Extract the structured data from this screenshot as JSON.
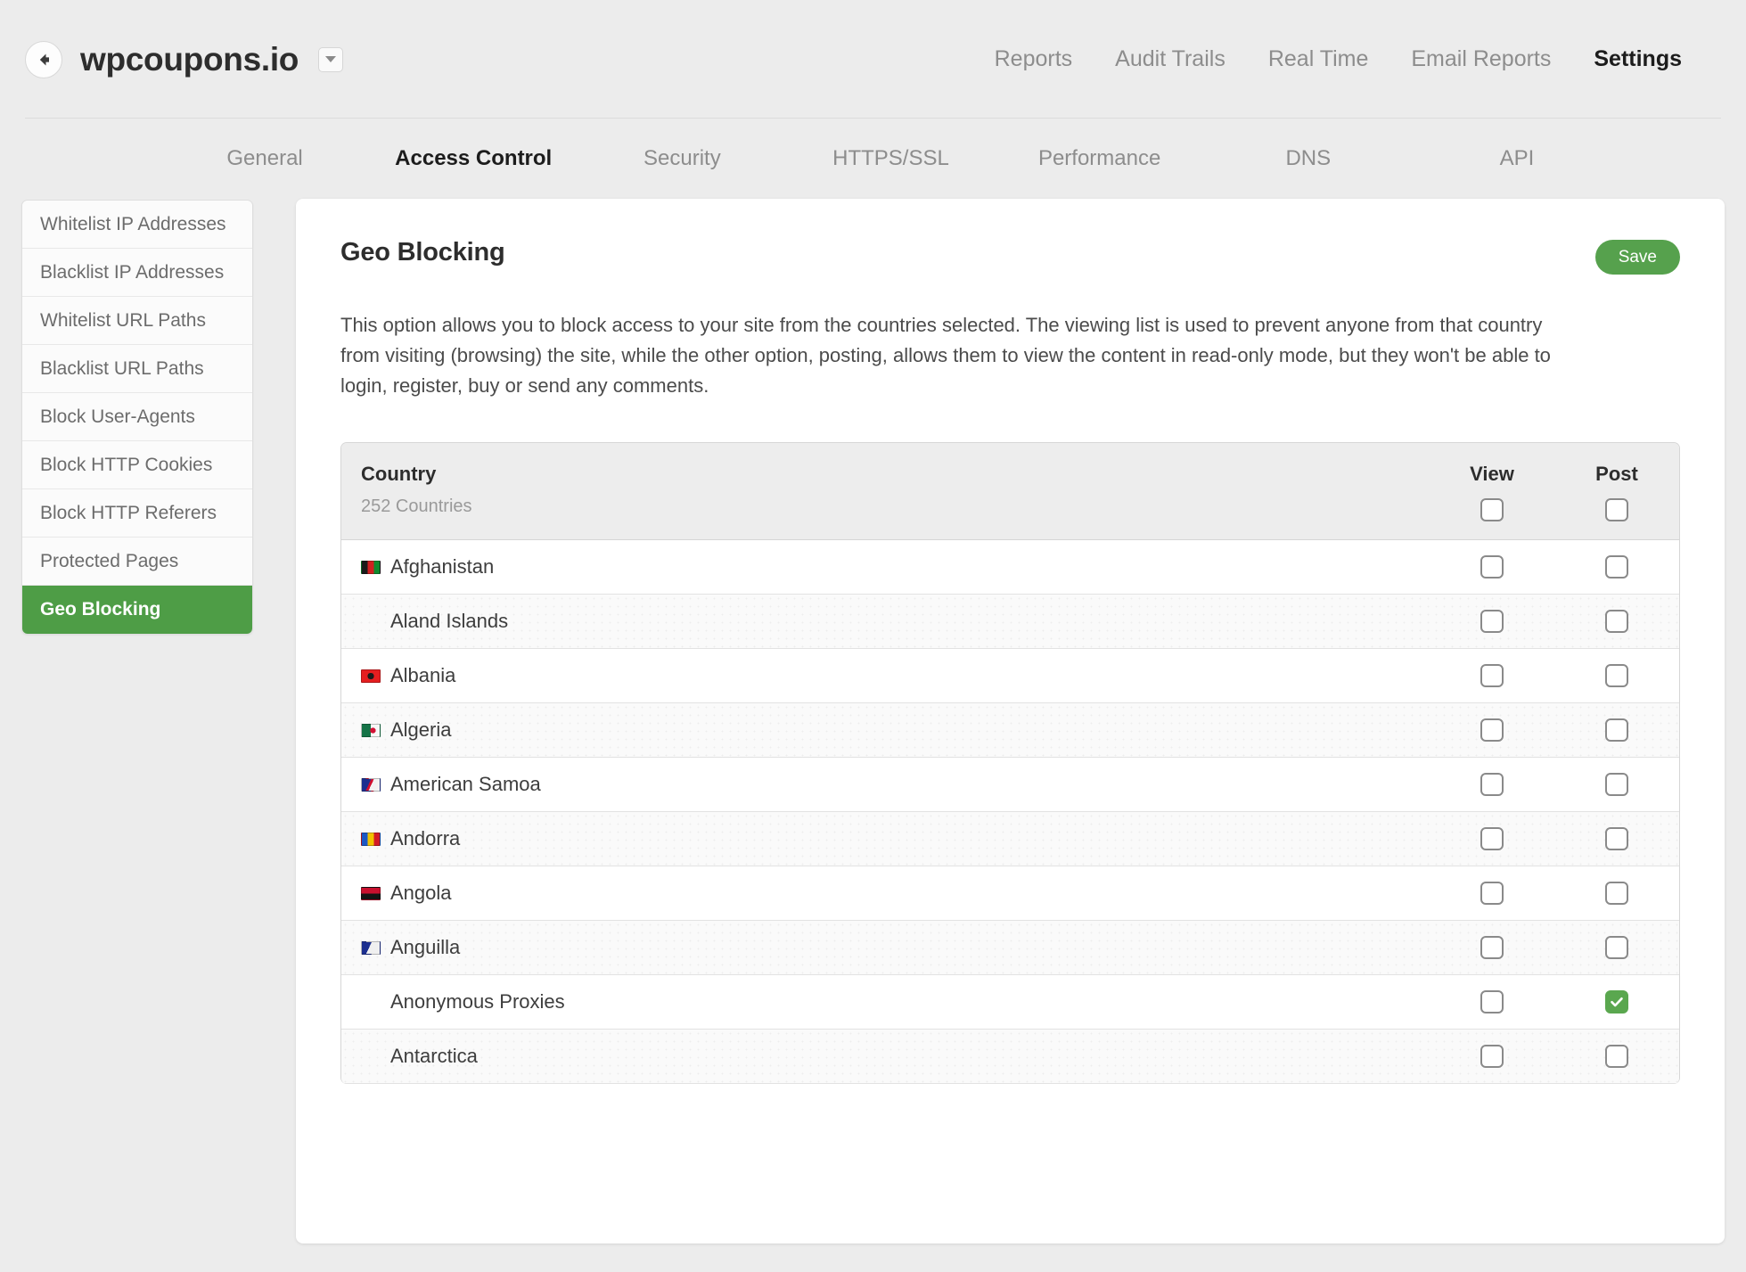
{
  "header": {
    "back_icon": "arrow-left-circle-icon",
    "site_title": "wpcoupons.io",
    "site_dropdown_icon": "chevron-down-icon",
    "nav": [
      {
        "label": "Reports",
        "active": false
      },
      {
        "label": "Audit Trails",
        "active": false
      },
      {
        "label": "Real Time",
        "active": false
      },
      {
        "label": "Email Reports",
        "active": false
      },
      {
        "label": "Settings",
        "active": true
      }
    ]
  },
  "subtabs": [
    {
      "label": "General",
      "active": false
    },
    {
      "label": "Access Control",
      "active": true
    },
    {
      "label": "Security",
      "active": false
    },
    {
      "label": "HTTPS/SSL",
      "active": false
    },
    {
      "label": "Performance",
      "active": false
    },
    {
      "label": "DNS",
      "active": false
    },
    {
      "label": "API",
      "active": false
    }
  ],
  "sidebar": {
    "items": [
      {
        "label": "Whitelist IP Addresses",
        "active": false
      },
      {
        "label": "Blacklist IP Addresses",
        "active": false
      },
      {
        "label": "Whitelist URL Paths",
        "active": false
      },
      {
        "label": "Blacklist URL Paths",
        "active": false
      },
      {
        "label": "Block User-Agents",
        "active": false
      },
      {
        "label": "Block HTTP Cookies",
        "active": false
      },
      {
        "label": "Block HTTP Referers",
        "active": false
      },
      {
        "label": "Protected Pages",
        "active": false
      },
      {
        "label": "Geo Blocking",
        "active": true
      }
    ]
  },
  "panel": {
    "title": "Geo Blocking",
    "save_label": "Save",
    "description": "This option allows you to block access to your site from the countries selected. The viewing list is used to prevent anyone from that country from visiting (browsing) the site, while the other option, posting, allows them to view the content in read-only mode, but they won't be able to login, register, buy or send any comments."
  },
  "table": {
    "country_header": "Country",
    "country_count": "252 Countries",
    "view_header": "View",
    "post_header": "Post",
    "header_view_checked": false,
    "header_post_checked": false,
    "rows": [
      {
        "name": "Afghanistan",
        "flag": "af",
        "view": false,
        "post": false
      },
      {
        "name": "Aland Islands",
        "flag": null,
        "view": false,
        "post": false
      },
      {
        "name": "Albania",
        "flag": "al",
        "view": false,
        "post": false
      },
      {
        "name": "Algeria",
        "flag": "dz",
        "view": false,
        "post": false
      },
      {
        "name": "American Samoa",
        "flag": "as",
        "view": false,
        "post": false
      },
      {
        "name": "Andorra",
        "flag": "ad",
        "view": false,
        "post": false
      },
      {
        "name": "Angola",
        "flag": "ao",
        "view": false,
        "post": false
      },
      {
        "name": "Anguilla",
        "flag": "ai",
        "view": false,
        "post": false
      },
      {
        "name": "Anonymous Proxies",
        "flag": null,
        "view": false,
        "post": true
      },
      {
        "name": "Antarctica",
        "flag": null,
        "view": false,
        "post": false
      }
    ]
  },
  "colors": {
    "accent_green": "#4e9d46",
    "save_green": "#56a14d",
    "checkbox_green": "#5aa74f",
    "page_background": "#ececec"
  }
}
